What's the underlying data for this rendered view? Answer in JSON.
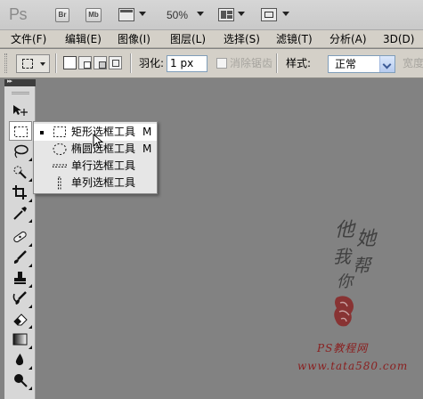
{
  "app": {
    "logo": "Ps",
    "bridge_button": "Br",
    "minibridge_button": "Mb",
    "zoom": "50%"
  },
  "menubar": {
    "items": [
      "文件(F)",
      "编辑(E)",
      "图像(I)",
      "图层(L)",
      "选择(S)",
      "滤镜(T)",
      "分析(A)",
      "3D(D)"
    ]
  },
  "options": {
    "feather_label": "羽化:",
    "feather_value": "1 px",
    "antialias_label": "消除锯齿",
    "style_label": "样式:",
    "style_value": "正常",
    "width_label": "宽度"
  },
  "toolbox": {
    "tools": [
      "move-tool",
      "rectangular-marquee-tool",
      "lasso-tool",
      "quick-selection-tool",
      "crop-tool",
      "eyedropper-tool",
      "spot-healing-brush-tool",
      "brush-tool",
      "clone-stamp-tool",
      "history-brush-tool",
      "eraser-tool",
      "gradient-tool",
      "blur-tool",
      "dodge-tool"
    ],
    "selected": "rectangular-marquee-tool"
  },
  "flyout": {
    "items": [
      {
        "label": "矩形选框工具",
        "shortcut": "M",
        "icon": "rect-marquee-icon",
        "selected": true
      },
      {
        "label": "椭圆选框工具",
        "shortcut": "M",
        "icon": "ellipse-marquee-icon",
        "selected": false
      },
      {
        "label": "单行选框工具",
        "shortcut": "",
        "icon": "single-row-marquee-icon",
        "selected": false
      },
      {
        "label": "单列选框工具",
        "shortcut": "",
        "icon": "single-column-marquee-icon",
        "selected": false
      }
    ]
  },
  "watermark": {
    "calligraphy": [
      "他",
      "她",
      "我",
      "帮",
      "你"
    ],
    "site_name": "PS教程网",
    "url": "www.tata580.com"
  },
  "colors": {
    "canvas_bg": "#828282",
    "menubar_bg": "#d4d0c8",
    "seal_red": "#8a1f1f"
  }
}
